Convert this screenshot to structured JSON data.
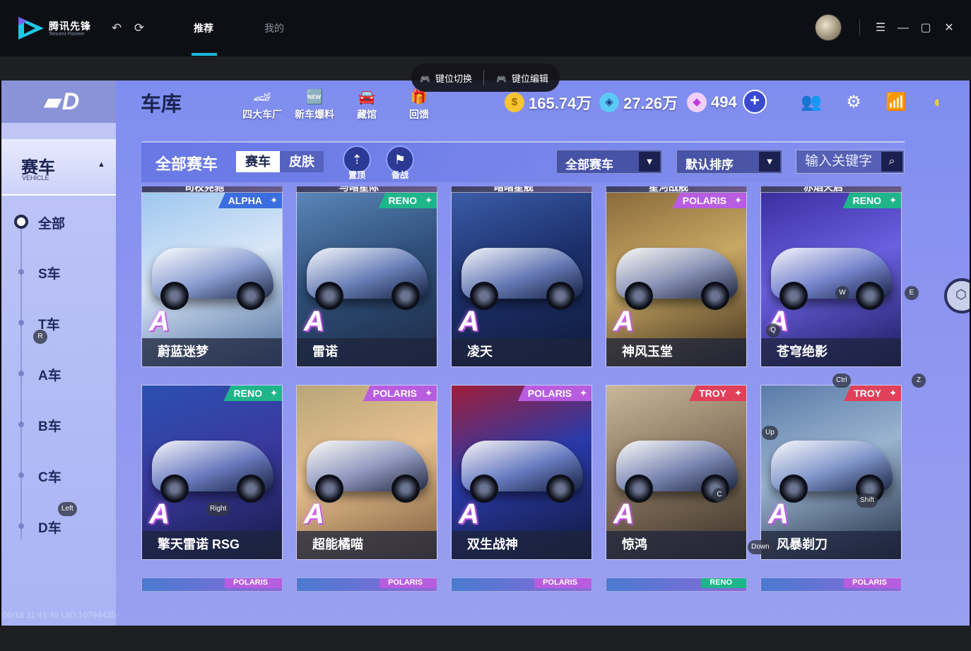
{
  "app": {
    "logo_title": "腾讯先锋",
    "logo_subtitle": "Tencent Pioneer",
    "tabs": [
      {
        "label": "推荐",
        "active": true
      },
      {
        "label": "我的",
        "active": false
      }
    ],
    "icons": {
      "back": "undo-icon",
      "refresh": "refresh-icon",
      "menu": "menu-icon",
      "minimize": "minimize-icon",
      "maximize": "maximize-icon",
      "close": "close-icon"
    }
  },
  "keybar": {
    "switch_label": "键位切换",
    "edit_label": "键位编辑"
  },
  "sidebar": {
    "category_cn": "赛车",
    "category_en": "VEHICLE",
    "items": [
      {
        "label": "全部",
        "active": true
      },
      {
        "label": "S车",
        "active": false
      },
      {
        "label": "T车",
        "active": false
      },
      {
        "label": "A车",
        "active": false
      },
      {
        "label": "B车",
        "active": false
      },
      {
        "label": "C车",
        "active": false
      },
      {
        "label": "D车",
        "active": false
      }
    ]
  },
  "header": {
    "title": "车库",
    "nav": [
      {
        "label": "四大车厂",
        "icon": "factory-icon"
      },
      {
        "label": "新车爆料",
        "icon": "new-badge-icon"
      },
      {
        "label": "藏馆",
        "icon": "garage-icon"
      },
      {
        "label": "回馈",
        "icon": "gift-icon"
      }
    ],
    "currencies": [
      {
        "name": "coins",
        "value": "165.74万",
        "icon": "coin-icon",
        "color": "#f6c531"
      },
      {
        "name": "vouchers",
        "value": "27.26万",
        "icon": "voucher-icon",
        "color": "#5bc8f5"
      },
      {
        "name": "diamonds",
        "value": "494",
        "icon": "diamond-icon",
        "color": "#e86ff2"
      }
    ],
    "right_icons": [
      "friends-mail-icon",
      "settings-gear-icon",
      "wifi-icon",
      "event-icon"
    ]
  },
  "filter": {
    "title": "全部赛车",
    "toggle": [
      "赛车",
      "皮肤"
    ],
    "buttons": [
      {
        "label": "置顶",
        "icon": "pin-top-icon"
      },
      {
        "label": "备战",
        "icon": "flag-icon"
      }
    ],
    "dropdown_type": "全部赛车",
    "dropdown_sort": "默认排序",
    "search_placeholder": "输入关键字"
  },
  "peek_top": [
    "司校尧驰",
    "与暗星际",
    "暗暗星舰",
    "星河战舰",
    "赤焰天启"
  ],
  "cars": [
    {
      "name": "蔚蓝迷梦",
      "brand": "ALPHA",
      "brand_color": "#3a6de0",
      "grade": "A",
      "bg": [
        "#9ec7f0",
        "#d8e6f7",
        "#4a6a9a"
      ]
    },
    {
      "name": "雷诺",
      "brand": "RENO",
      "brand_color": "#1fb58a",
      "grade": "A",
      "bg": [
        "#5a86b8",
        "#2f4f7a",
        "#1d2a44"
      ]
    },
    {
      "name": "凌天",
      "brand": "",
      "brand_color": "#1fb58a",
      "grade": "A",
      "bg": [
        "#3a5ca8",
        "#1c2f6a",
        "#0f1a3a"
      ]
    },
    {
      "name": "神风玉堂",
      "brand": "POLARIS",
      "brand_color": "#b85de0",
      "grade": "A",
      "bg": [
        "#8a6a3a",
        "#c8a864",
        "#3a2a1a"
      ]
    },
    {
      "name": "苍穹绝影",
      "brand": "RENO",
      "brand_color": "#1fb58a",
      "grade": "A",
      "bg": [
        "#3a2ea0",
        "#6a60e0",
        "#1a1a5a"
      ]
    },
    {
      "name": "擎天雷诺 RSG",
      "brand": "RENO",
      "brand_color": "#1fb58a",
      "grade": "A",
      "bg": [
        "#2a50b0",
        "#3a3aa0",
        "#141a44"
      ]
    },
    {
      "name": "超能橘喵",
      "brand": "POLARIS",
      "brand_color": "#b85de0",
      "grade": "A",
      "bg": [
        "#b8a67a",
        "#e8c090",
        "#7a5a3a"
      ]
    },
    {
      "name": "双生战神",
      "brand": "POLARIS",
      "brand_color": "#b85de0",
      "grade": "A",
      "bg": [
        "#a01e3a",
        "#2a3aa8",
        "#101838"
      ]
    },
    {
      "name": "惊鸿",
      "brand": "TROY",
      "brand_color": "#e0405a",
      "grade": "A",
      "bg": [
        "#c9b89a",
        "#8a7660",
        "#3a3028"
      ]
    },
    {
      "name": "风暴剃刀",
      "brand": "TROY",
      "brand_color": "#e0405a",
      "grade": "A",
      "bg": [
        "#5a7aa8",
        "#9ab4d0",
        "#1e2a40"
      ]
    }
  ],
  "peek_bottom_brands": [
    "POLARIS",
    "POLARIS",
    "POLARIS",
    "RENO",
    "POLARIS"
  ],
  "key_hints": [
    "R",
    "E",
    "W",
    "Q",
    "Ctrl",
    "Z",
    "Right",
    "Left",
    "Up",
    "Shift",
    "C",
    "Down"
  ],
  "status_text": "06/18 11:41:46 UID:10794435"
}
